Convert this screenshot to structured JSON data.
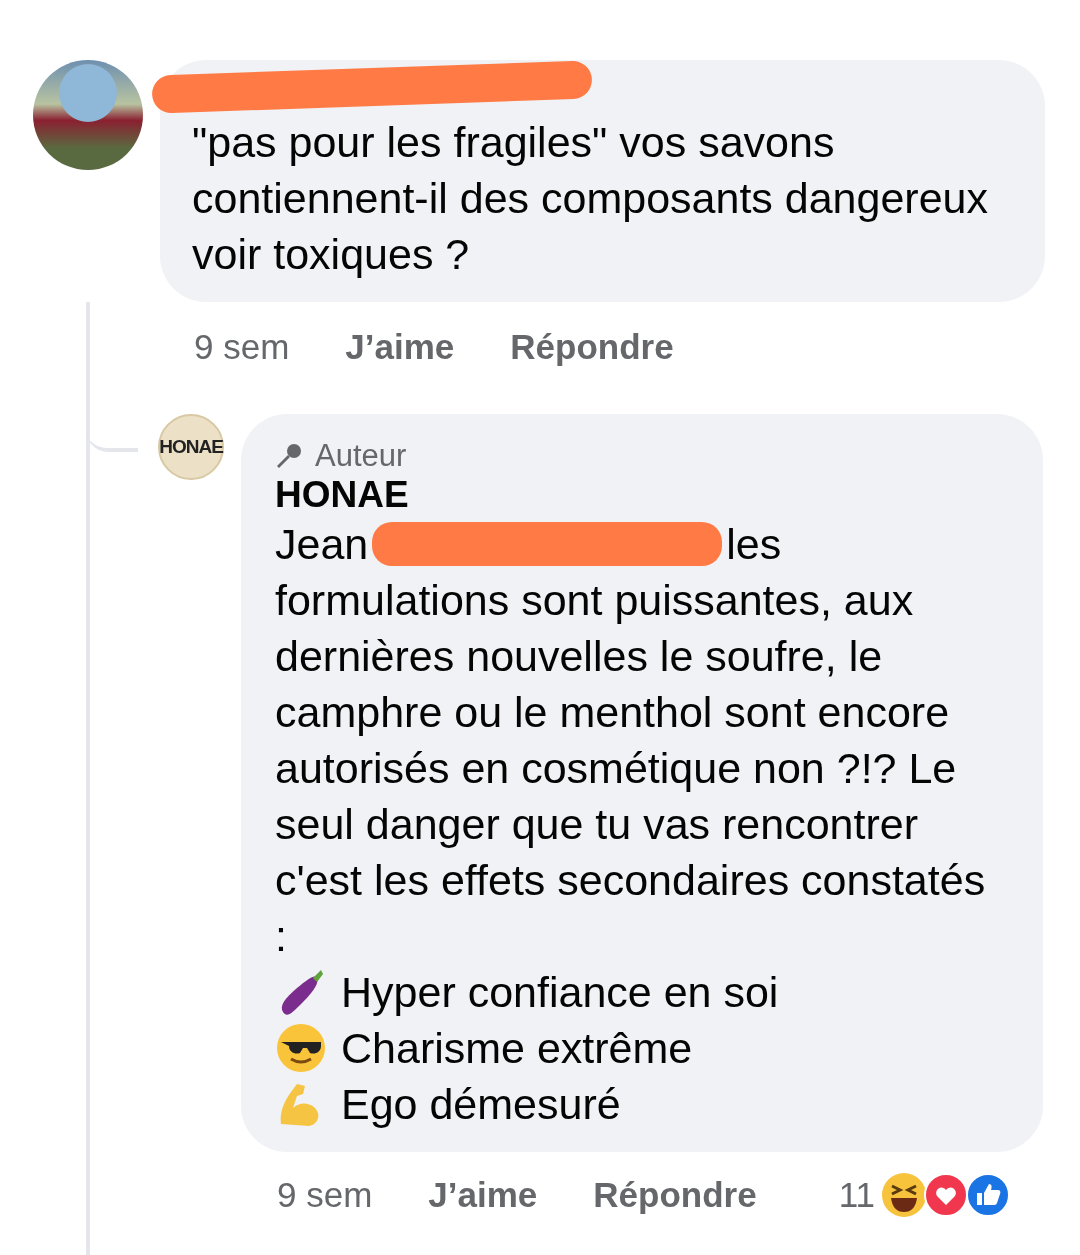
{
  "comment": {
    "text": "\"pas pour les fragiles\" vos savons contiennent-il des composants dangereux voir toxiques ?",
    "actions": {
      "time": "9 sem",
      "like": "J’aime",
      "reply": "Répondre"
    }
  },
  "reply": {
    "badge": "Auteur",
    "author": "HONAE",
    "avatar_text": "HONAE",
    "lead": "Jean",
    "after": "les",
    "rest": "formulations sont puissantes, aux dernières nouvelles le soufre, le camphre ou le menthol sont encore autorisés en cosmétique non ?!? Le seul danger que tu vas rencontrer c'est les effets secondaires constatés :",
    "list": [
      {
        "kind": "eggplant",
        "text": "Hyper confiance en soi"
      },
      {
        "kind": "sunglasses",
        "text": "Charisme extrême"
      },
      {
        "kind": "muscle",
        "text": "Ego démesuré"
      }
    ],
    "actions": {
      "time": "9 sem",
      "like": "J’aime",
      "reply": "Répondre",
      "count": "11"
    }
  }
}
